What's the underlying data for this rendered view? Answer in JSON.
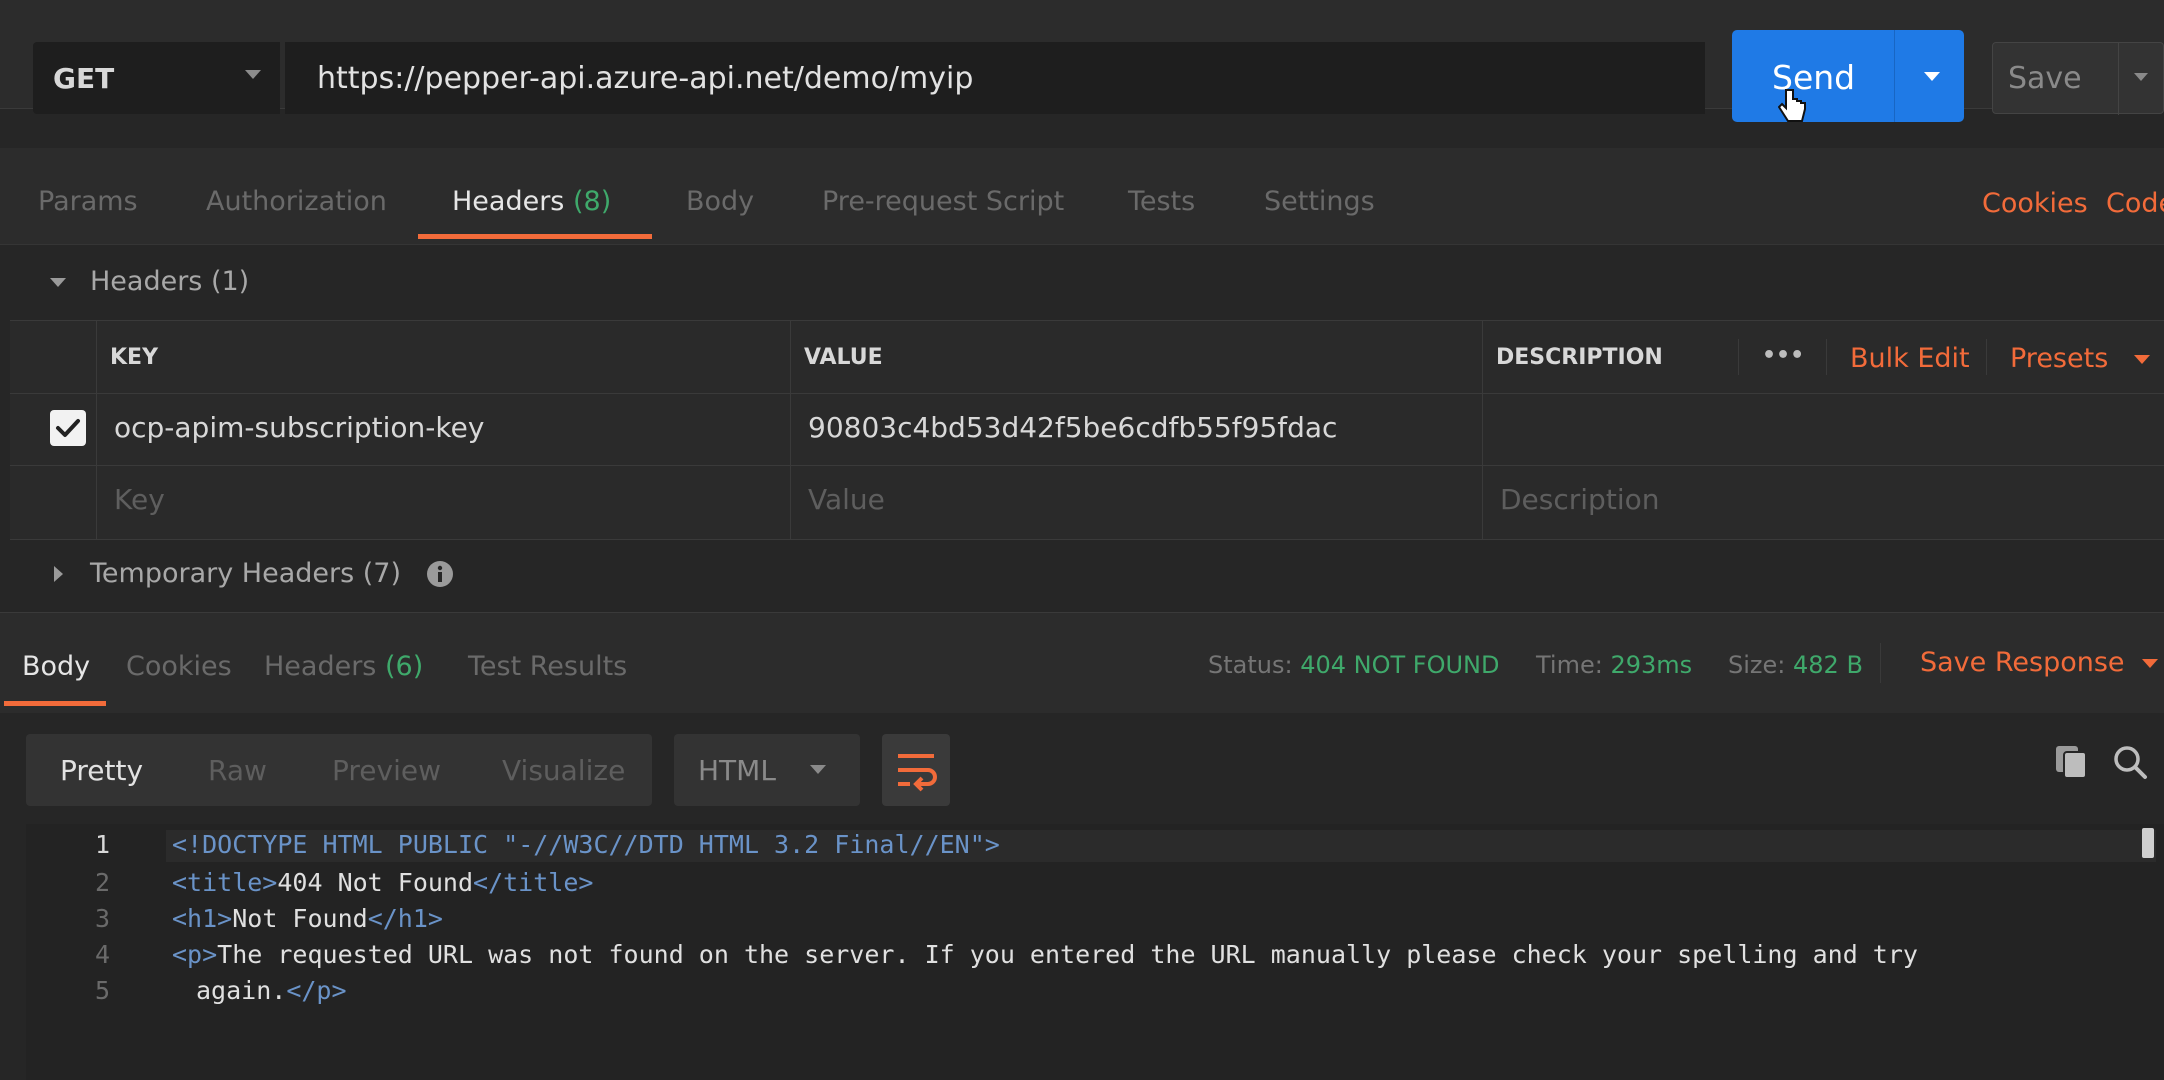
{
  "request": {
    "method": "GET",
    "url": "https://pepper-api.azure-api.net/demo/myip",
    "send_label": "Send",
    "save_label": "Save"
  },
  "request_tabs": {
    "params": "Params",
    "authorization": "Authorization",
    "headers": "Headers",
    "headers_count": "(8)",
    "body": "Body",
    "prerequest": "Pre-request Script",
    "tests": "Tests",
    "settings": "Settings",
    "cookies": "Cookies",
    "code": "Code"
  },
  "headers_section": {
    "title": "Headers (1)",
    "columns": {
      "key": "KEY",
      "value": "VALUE",
      "description": "DESCRIPTION"
    },
    "more": "•••",
    "bulk_edit": "Bulk Edit",
    "presets": "Presets",
    "rows": [
      {
        "checked": true,
        "key": "ocp-apim-subscription-key",
        "value": "90803c4bd53d42f5be6cdfb55f95fdac",
        "description": ""
      }
    ],
    "placeholders": {
      "key": "Key",
      "value": "Value",
      "description": "Description"
    },
    "temporary_title": "Temporary Headers (7)"
  },
  "response": {
    "tabs": {
      "body": "Body",
      "cookies": "Cookies",
      "headers": "Headers",
      "headers_count": "(6)",
      "test_results": "Test Results"
    },
    "status_label": "Status:",
    "status_value": "404 NOT FOUND",
    "time_label": "Time:",
    "time_value": "293ms",
    "size_label": "Size:",
    "size_value": "482 B",
    "save_response": "Save Response",
    "views": {
      "pretty": "Pretty",
      "raw": "Raw",
      "preview": "Preview",
      "visualize": "Visualize"
    },
    "language": "HTML",
    "code": {
      "line_numbers": [
        "1",
        "2",
        "3",
        "4",
        "5"
      ],
      "l1_open": "<",
      "l1_text": "!DOCTYPE HTML PUBLIC \"-//W3C//DTD HTML 3.2 Final//EN\"",
      "l1_close": ">",
      "l2_open": "<title>",
      "l2_text": "404 Not Found",
      "l2_close": "</title>",
      "l3_open": "<h1>",
      "l3_text": "Not Found",
      "l3_close": "</h1>",
      "l4_open": "<p>",
      "l4_text": "The requested URL was not found on the server. If you entered the URL manually please check your spelling and try",
      "l5_text": "again.",
      "l5_close": "</p>"
    }
  },
  "colors": {
    "accent_orange": "#f26b3a",
    "send_blue": "#1f7ae6",
    "status_green": "#3fa96b",
    "background": "#262626"
  }
}
